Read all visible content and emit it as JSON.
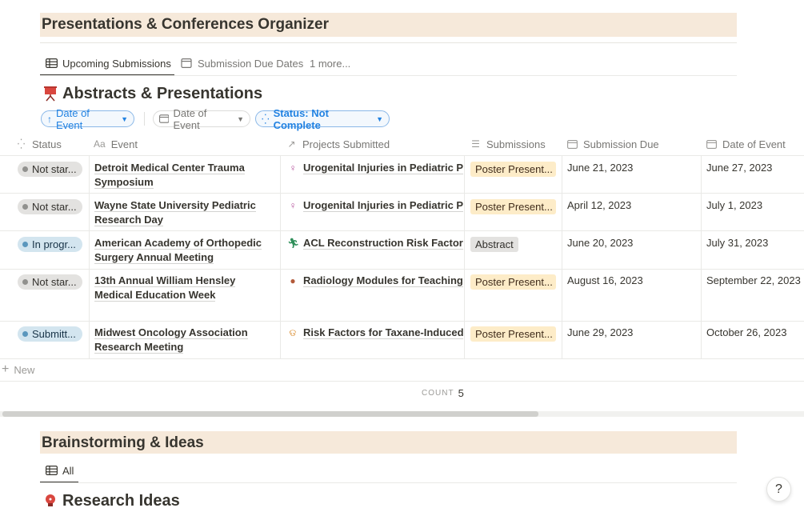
{
  "page": {
    "organizer_title": "Presentations & Conferences Organizer",
    "organizer_tabs": [
      {
        "label": "Upcoming Submissions",
        "icon": "table-icon",
        "active": true
      },
      {
        "label": "Submission Due Dates",
        "icon": "calendar-icon",
        "active": false
      },
      {
        "label": "1 more...",
        "icon": "",
        "active": false
      }
    ],
    "db1": {
      "title": "Abstracts & Presentations",
      "icon": "presentation-board-icon",
      "filters": [
        {
          "label": "Date of Event",
          "icon": "arrow-up-icon",
          "style": "blue"
        },
        {
          "label": "Date of Event",
          "icon": "calendar-icon",
          "style": "grey"
        },
        {
          "label": "Status: Not Complete",
          "icon": "status-spinner-icon",
          "style": "blue"
        }
      ],
      "columns": [
        "Status",
        "Event",
        "Projects Submitted",
        "Submissions",
        "Submission Due",
        "Date of Event"
      ],
      "rows": [
        {
          "status": "Not star...",
          "status_color": "grey",
          "event": "Detroit Medical Center Trauma Symposium",
          "project": "Urogenital Injuries in Pediatric Pelvic",
          "project_icon": "person-icon",
          "submission": "Poster Present...",
          "submission_color": "yellow",
          "due": "June 21, 2023",
          "event_date": "June 27, 2023"
        },
        {
          "status": "Not star...",
          "status_color": "grey",
          "event": "Wayne State University Pediatric Research Day",
          "project": "Urogenital Injuries in Pediatric Pelvic",
          "project_icon": "person-icon",
          "submission": "Poster Present...",
          "submission_color": "yellow",
          "due": "April 12, 2023",
          "event_date": "July 1, 2023"
        },
        {
          "status": "In progr...",
          "status_color": "blue",
          "event": "American Academy of Orthopedic Surgery Annual Meeting",
          "project": "ACL Reconstruction Risk Factors for",
          "project_icon": "runner-icon",
          "submission": "Abstract",
          "submission_color": "grey",
          "due": "June 20, 2023",
          "event_date": "July 31, 2023"
        },
        {
          "status": "Not star...",
          "status_color": "grey",
          "event": "13th Annual William Hensley Medical Education Week",
          "project": "Radiology Modules for Teaching Me",
          "project_icon": "stomach-icon",
          "submission": "Poster Present...",
          "submission_color": "yellow",
          "due": "August 16, 2023",
          "event_date": "September 22, 2023"
        },
        {
          "status": "Submitt...",
          "status_color": "blue",
          "event": "Midwest Oncology Association Research Meeting",
          "project": "Risk Factors for Taxane-Induced Ne",
          "project_icon": "cancer-ribbon-icon",
          "submission": "Poster Present...",
          "submission_color": "yellow",
          "due": "June 29, 2023",
          "event_date": "October 26, 2023"
        }
      ],
      "new_label": "New",
      "count_label": "COUNT",
      "count_value": "5"
    },
    "brainstorm_title": "Brainstorming & Ideas",
    "brainstorm_tabs": [
      {
        "label": "All",
        "icon": "table-icon",
        "active": true
      }
    ],
    "db2": {
      "title": "Research Ideas",
      "icon": "lightbulb-icon"
    },
    "help_label": "?",
    "colors": {
      "banner": "#f6e9da",
      "accent_blue": "#2383e2",
      "tag_yellow": "#fdecc8",
      "tag_grey": "#e3e2e0",
      "status_blue": "#d3e5ef"
    }
  }
}
